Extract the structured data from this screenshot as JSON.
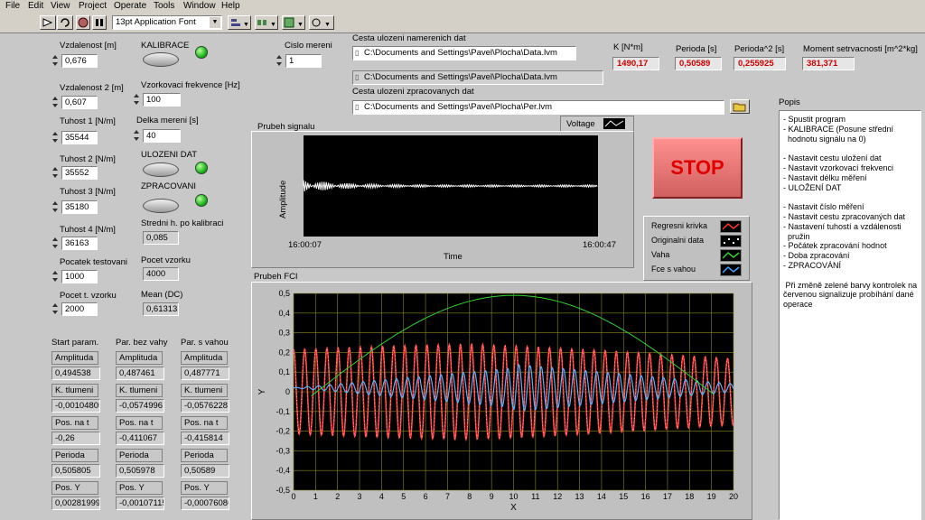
{
  "menu": [
    "File",
    "Edit",
    "View",
    "Project",
    "Operate",
    "Tools",
    "Window",
    "Help"
  ],
  "toolbar": {
    "font_select": "13pt Application Font"
  },
  "inputs": {
    "vzdalenost_label": "Vzdalenost [m]",
    "vzdalenost": "0,676",
    "vzdalenost2_label": "Vzdalenost 2 [m]",
    "vzdalenost2": "0,607",
    "tuhost1_label": "Tuhost 1 [N/m]",
    "tuhost1": "35544",
    "tuhost2_label": "Tuhost 2 [N/m]",
    "tuhost2": "35552",
    "tuhost3_label": "Tuhost 3 [N/m]",
    "tuhost3": "35180",
    "tuhost4_label": "Tuhost 4 [N/m]",
    "tuhost4": "36163",
    "pocatek_label": "Pocatek testovani",
    "pocatek": "1000",
    "pocet_label": "Pocet t. vzorku",
    "pocet": "2000",
    "kalibrace_label": "KALIBRACE",
    "vzork_label": "Vzorkovaci frekvence [Hz]",
    "vzork": "100",
    "delka_label": "Delka mereni [s]",
    "delka": "40",
    "ulozeni_label": "ULOZENI DAT",
    "zpracovani_label": "ZPRACOVANI",
    "stredni_label": "Stredni h. po kalibraci",
    "stredni": "0,085",
    "pocetvz_label": "Pocet vzorku",
    "pocetvz": "4000",
    "mean_label": "Mean (DC)",
    "mean": "0,613132",
    "cislo_label": "Cislo mereni",
    "cislo": "1"
  },
  "params": {
    "headers": [
      "Start param.",
      "Par. bez vahy",
      "Par. s vahou"
    ],
    "rows": [
      {
        "label": "Amplituda",
        "values": [
          "0,494538",
          "0,487461",
          "0,487771"
        ]
      },
      {
        "label": "K. tlumeni",
        "values": [
          "-0,00104805",
          "-0,0574996",
          "-0,0576228"
        ]
      },
      {
        "label": "Pos. na t",
        "values": [
          "-0,26",
          "-0,411067",
          "-0,415814"
        ]
      },
      {
        "label": "Perioda",
        "values": [
          "0,505805",
          "0,505978",
          "0,50589"
        ]
      },
      {
        "label": "Pos. Y",
        "values": [
          "0,00281999",
          "-0,00107115",
          "-0,00076086"
        ]
      }
    ]
  },
  "paths": {
    "save_label": "Cesta ulozeni namerenich dat",
    "save_path": "C:\\Documents and Settings\\Pavel\\Plocha\\Data.lvm",
    "save_path2": "C:\\Documents and Settings\\Pavel\\Plocha\\Data.lvm",
    "proc_label": "Cesta ulozeni zpracovanych dat",
    "proc_path": "C:\\Documents and Settings\\Pavel\\Plocha\\Per.lvm"
  },
  "results": {
    "k_label": "K [N*m]",
    "k": "1490,17",
    "perioda_label": "Perioda [s]",
    "perioda": "0,50589",
    "perioda2_label": "Perioda^2 [s]",
    "perioda2": "0,255925",
    "moment_label": "Moment setrvacnosti [m^2*kg]",
    "moment": "381,371"
  },
  "stop_label": "STOP",
  "signal_chart": {
    "title": "Prubeh signalu",
    "legend": "Voltage",
    "ylabel": "Amplitude",
    "xlabel": "Time",
    "x_start": "16:00:07",
    "x_end": "16:00:47"
  },
  "legend": {
    "items": [
      {
        "name": "Regresni krivka",
        "color": "#ff3030"
      },
      {
        "name": "Originalni data",
        "color": "#ffffff"
      },
      {
        "name": "Vaha",
        "color": "#30d030"
      },
      {
        "name": "Fce s vahou",
        "color": "#40a0ff"
      }
    ]
  },
  "popis": {
    "label": "Popis",
    "lines": [
      "- Spustit program",
      "- KALIBRACE (Posune střední",
      "  hodnotu signálu na 0)",
      "",
      "- Nastavit cestu uložení dat",
      "- Nastavit vzorkovací frekvenci",
      "- Nastavit délku měření",
      "- ULOŽENÍ DAT",
      "",
      "- Nastavit číslo měření",
      "- Nastavit cestu zpracovaných dat",
      "- Nastavení tuhostí a vzdálenosti",
      "  pružin",
      "- Počátek zpracování hodnot",
      "- Doba zpracování",
      "- ZPRACOVÁNÍ",
      "",
      " Při změně zelené barvy kontrolek na",
      "červenou signalizuje probíhání dané",
      "operace"
    ]
  },
  "chart_data": {
    "type": "line",
    "title": "Prubeh FCI",
    "xlabel": "X",
    "ylabel": "Y",
    "xlim": [
      0,
      20
    ],
    "ylim": [
      -0.5,
      0.5
    ],
    "xticks": [
      0,
      1,
      2,
      3,
      4,
      5,
      6,
      7,
      8,
      9,
      10,
      11,
      12,
      13,
      14,
      15,
      16,
      17,
      18,
      19,
      20
    ],
    "yticks": [
      0.5,
      0.4,
      0.3,
      0.2,
      0.1,
      0,
      -0.1,
      -0.2,
      -0.3,
      -0.4,
      -0.5
    ],
    "yticklabels": [
      "0,5",
      "0,4",
      "0,3",
      "0,2",
      "0,1",
      "0",
      "-0,1",
      "-0,2",
      "-0,3",
      "-0,4",
      "-0,5"
    ],
    "series": [
      {
        "name": "Regresni krivka",
        "amplitude": 0.4875,
        "period": 0.5059,
        "damping": -0.0575
      },
      {
        "name": "Vaha",
        "peak_x": 10,
        "peak_y": 0.49,
        "x_range": [
          0.8,
          19.2
        ]
      },
      {
        "name": "Fce s vahou"
      }
    ],
    "background": "#000000",
    "grid": true
  }
}
